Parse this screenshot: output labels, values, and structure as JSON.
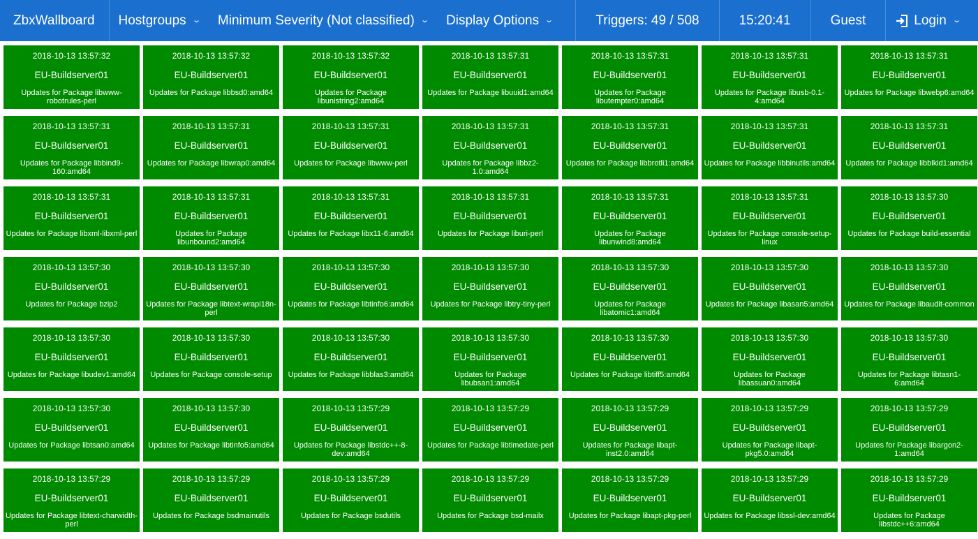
{
  "colors": {
    "navbar": "#1a6fcf",
    "tile_ok": "#008a00",
    "text": "#ffffff"
  },
  "navbar": {
    "brand": "ZbxWallboard",
    "hostgroups": "Hostgroups",
    "min_severity": "Minimum Severity (Not classified)",
    "display_options": "Display Options",
    "triggers": "Triggers: 49 / 508",
    "clock": "15:20:41",
    "user": "Guest",
    "login": "Login",
    "login_icon": "sign-in-icon",
    "caret_icon": "chevron-down-icon"
  },
  "tiles": [
    {
      "time": "2018-10-13 13:57:32",
      "host": "EU-Buildserver01",
      "desc": "Updates for Package libwww-robotrules-perl"
    },
    {
      "time": "2018-10-13 13:57:32",
      "host": "EU-Buildserver01",
      "desc": "Updates for Package libbsd0:amd64"
    },
    {
      "time": "2018-10-13 13:57:32",
      "host": "EU-Buildserver01",
      "desc": "Updates for Package libunistring2:amd64"
    },
    {
      "time": "2018-10-13 13:57:31",
      "host": "EU-Buildserver01",
      "desc": "Updates for Package libuuid1:amd64"
    },
    {
      "time": "2018-10-13 13:57:31",
      "host": "EU-Buildserver01",
      "desc": "Updates for Package libutempter0:amd64"
    },
    {
      "time": "2018-10-13 13:57:31",
      "host": "EU-Buildserver01",
      "desc": "Updates for Package libusb-0.1-4:amd64"
    },
    {
      "time": "2018-10-13 13:57:31",
      "host": "EU-Buildserver01",
      "desc": "Updates for Package libwebp6:amd64"
    },
    {
      "time": "2018-10-13 13:57:31",
      "host": "EU-Buildserver01",
      "desc": "Updates for Package libbind9-160:amd64"
    },
    {
      "time": "2018-10-13 13:57:31",
      "host": "EU-Buildserver01",
      "desc": "Updates for Package libwrap0:amd64"
    },
    {
      "time": "2018-10-13 13:57:31",
      "host": "EU-Buildserver01",
      "desc": "Updates for Package libwww-perl"
    },
    {
      "time": "2018-10-13 13:57:31",
      "host": "EU-Buildserver01",
      "desc": "Updates for Package libbz2-1.0:amd64"
    },
    {
      "time": "2018-10-13 13:57:31",
      "host": "EU-Buildserver01",
      "desc": "Updates for Package libbrotli1:amd64"
    },
    {
      "time": "2018-10-13 13:57:31",
      "host": "EU-Buildserver01",
      "desc": "Updates for Package libbinutils:amd64"
    },
    {
      "time": "2018-10-13 13:57:31",
      "host": "EU-Buildserver01",
      "desc": "Updates for Package libblkid1:amd64"
    },
    {
      "time": "2018-10-13 13:57:31",
      "host": "EU-Buildserver01",
      "desc": "Updates for Package libxml-libxml-perl"
    },
    {
      "time": "2018-10-13 13:57:31",
      "host": "EU-Buildserver01",
      "desc": "Updates for Package libunbound2:amd64"
    },
    {
      "time": "2018-10-13 13:57:31",
      "host": "EU-Buildserver01",
      "desc": "Updates for Package libx11-6:amd64"
    },
    {
      "time": "2018-10-13 13:57:31",
      "host": "EU-Buildserver01",
      "desc": "Updates for Package liburi-perl"
    },
    {
      "time": "2018-10-13 13:57:31",
      "host": "EU-Buildserver01",
      "desc": "Updates for Package libunwind8:amd64"
    },
    {
      "time": "2018-10-13 13:57:31",
      "host": "EU-Buildserver01",
      "desc": "Updates for Package console-setup-linux"
    },
    {
      "time": "2018-10-13 13:57:30",
      "host": "EU-Buildserver01",
      "desc": "Updates for Package build-essential"
    },
    {
      "time": "2018-10-13 13:57:30",
      "host": "EU-Buildserver01",
      "desc": "Updates for Package bzip2"
    },
    {
      "time": "2018-10-13 13:57:30",
      "host": "EU-Buildserver01",
      "desc": "Updates for Package libtext-wrapi18n-perl"
    },
    {
      "time": "2018-10-13 13:57:30",
      "host": "EU-Buildserver01",
      "desc": "Updates for Package libtinfo6:amd64"
    },
    {
      "time": "2018-10-13 13:57:30",
      "host": "EU-Buildserver01",
      "desc": "Updates for Package libtry-tiny-perl"
    },
    {
      "time": "2018-10-13 13:57:30",
      "host": "EU-Buildserver01",
      "desc": "Updates for Package libatomic1:amd64"
    },
    {
      "time": "2018-10-13 13:57:30",
      "host": "EU-Buildserver01",
      "desc": "Updates for Package libasan5:amd64"
    },
    {
      "time": "2018-10-13 13:57:30",
      "host": "EU-Buildserver01",
      "desc": "Updates for Package libaudit-common"
    },
    {
      "time": "2018-10-13 13:57:30",
      "host": "EU-Buildserver01",
      "desc": "Updates for Package libudev1:amd64"
    },
    {
      "time": "2018-10-13 13:57:30",
      "host": "EU-Buildserver01",
      "desc": "Updates for Package console-setup"
    },
    {
      "time": "2018-10-13 13:57:30",
      "host": "EU-Buildserver01",
      "desc": "Updates for Package libblas3:amd64"
    },
    {
      "time": "2018-10-13 13:57:30",
      "host": "EU-Buildserver01",
      "desc": "Updates for Package libubsan1:amd64"
    },
    {
      "time": "2018-10-13 13:57:30",
      "host": "EU-Buildserver01",
      "desc": "Updates for Package libtiff5:amd64"
    },
    {
      "time": "2018-10-13 13:57:30",
      "host": "EU-Buildserver01",
      "desc": "Updates for Package libassuan0:amd64"
    },
    {
      "time": "2018-10-13 13:57:30",
      "host": "EU-Buildserver01",
      "desc": "Updates for Package libtasn1-6:amd64"
    },
    {
      "time": "2018-10-13 13:57:30",
      "host": "EU-Buildserver01",
      "desc": "Updates for Package libtsan0:amd64"
    },
    {
      "time": "2018-10-13 13:57:30",
      "host": "EU-Buildserver01",
      "desc": "Updates for Package libtinfo5:amd64"
    },
    {
      "time": "2018-10-13 13:57:29",
      "host": "EU-Buildserver01",
      "desc": "Updates for Package libstdc++-8-dev:amd64"
    },
    {
      "time": "2018-10-13 13:57:29",
      "host": "EU-Buildserver01",
      "desc": "Updates for Package libtimedate-perl"
    },
    {
      "time": "2018-10-13 13:57:29",
      "host": "EU-Buildserver01",
      "desc": "Updates for Package libapt-inst2.0:amd64"
    },
    {
      "time": "2018-10-13 13:57:29",
      "host": "EU-Buildserver01",
      "desc": "Updates for Package libapt-pkg5.0:amd64"
    },
    {
      "time": "2018-10-13 13:57:29",
      "host": "EU-Buildserver01",
      "desc": "Updates for Package libargon2-1:amd64"
    },
    {
      "time": "2018-10-13 13:57:29",
      "host": "EU-Buildserver01",
      "desc": "Updates for Package libtext-charwidth-perl"
    },
    {
      "time": "2018-10-13 13:57:29",
      "host": "EU-Buildserver01",
      "desc": "Updates for Package bsdmainutils"
    },
    {
      "time": "2018-10-13 13:57:29",
      "host": "EU-Buildserver01",
      "desc": "Updates for Package bsdutils"
    },
    {
      "time": "2018-10-13 13:57:29",
      "host": "EU-Buildserver01",
      "desc": "Updates for Package bsd-mailx"
    },
    {
      "time": "2018-10-13 13:57:29",
      "host": "EU-Buildserver01",
      "desc": "Updates for Package libapt-pkg-perl"
    },
    {
      "time": "2018-10-13 13:57:29",
      "host": "EU-Buildserver01",
      "desc": "Updates for Package libssl-dev:amd64"
    },
    {
      "time": "2018-10-13 13:57:29",
      "host": "EU-Buildserver01",
      "desc": "Updates for Package libstdc++6:amd64"
    }
  ]
}
